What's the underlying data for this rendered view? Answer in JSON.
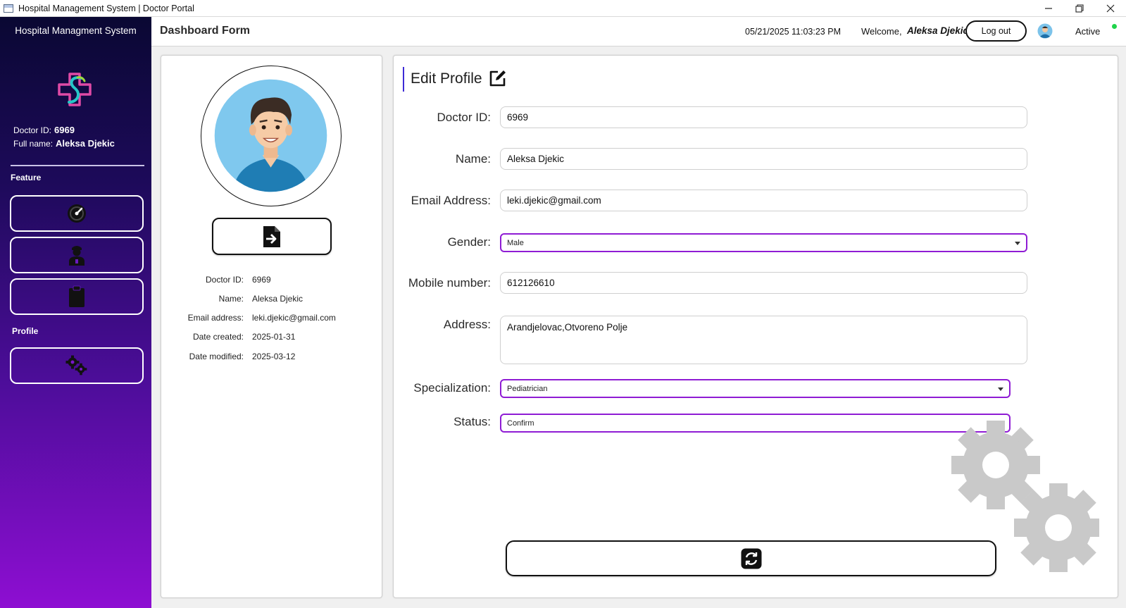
{
  "window": {
    "title": "Hospital Management System | Doctor Portal",
    "controls": [
      "minimize",
      "restore",
      "close"
    ]
  },
  "sidebar": {
    "app_title": "Hospital Managment System",
    "doctor_id_label": "Doctor ID:",
    "doctor_id": "6969",
    "full_name_label": "Full name:",
    "full_name": "Aleksa Djekic",
    "feature_heading": "Feature",
    "profile_heading": "Profile",
    "buttons": [
      {
        "icon": "dashboard-gauge-icon"
      },
      {
        "icon": "doctor-icon"
      },
      {
        "icon": "clipboard-icon"
      },
      {
        "icon": "gears-icon"
      }
    ]
  },
  "header": {
    "page_title": "Dashboard Form",
    "datetime": "05/21/2025 11:03:23 PM",
    "welcome_label": "Welcome,",
    "user_name": "Aleksa Djekic",
    "logout_label": "Log out",
    "status": "Active",
    "status_color": "#1fd34a"
  },
  "profile_card": {
    "import_button_icon": "file-import-icon",
    "rows": [
      {
        "label": "Doctor ID:",
        "value": "6969"
      },
      {
        "label": "Name:",
        "value": "Aleksa Djekic"
      },
      {
        "label": "Email address:",
        "value": "leki.djekic@gmail.com"
      },
      {
        "label": "Date created:",
        "value": "2025-01-31"
      },
      {
        "label": "Date modified:",
        "value": "2025-03-12"
      }
    ]
  },
  "edit_form": {
    "title": "Edit Profile",
    "fields": {
      "doctor_id": {
        "label": "Doctor ID:",
        "value": "6969"
      },
      "name": {
        "label": "Name:",
        "value": "Aleksa Djekic"
      },
      "email": {
        "label": "Email Address:",
        "value": "leki.djekic@gmail.com"
      },
      "gender": {
        "label": "Gender:",
        "value": "Male"
      },
      "mobile": {
        "label": "Mobile number:",
        "value": "612126610"
      },
      "address": {
        "label": "Address:",
        "value": "Arandjelovac,Otvoreno Polje"
      },
      "specialization": {
        "label": "Specialization:",
        "value": "Pediatrician"
      },
      "status": {
        "label": "Status:",
        "value": "Confirm"
      }
    },
    "update_button_icon": "refresh-icon"
  },
  "colors": {
    "accent_purple": "#8f1cd4",
    "sidebar_top": "#0a0833",
    "sidebar_bottom": "#8e0ed2"
  }
}
